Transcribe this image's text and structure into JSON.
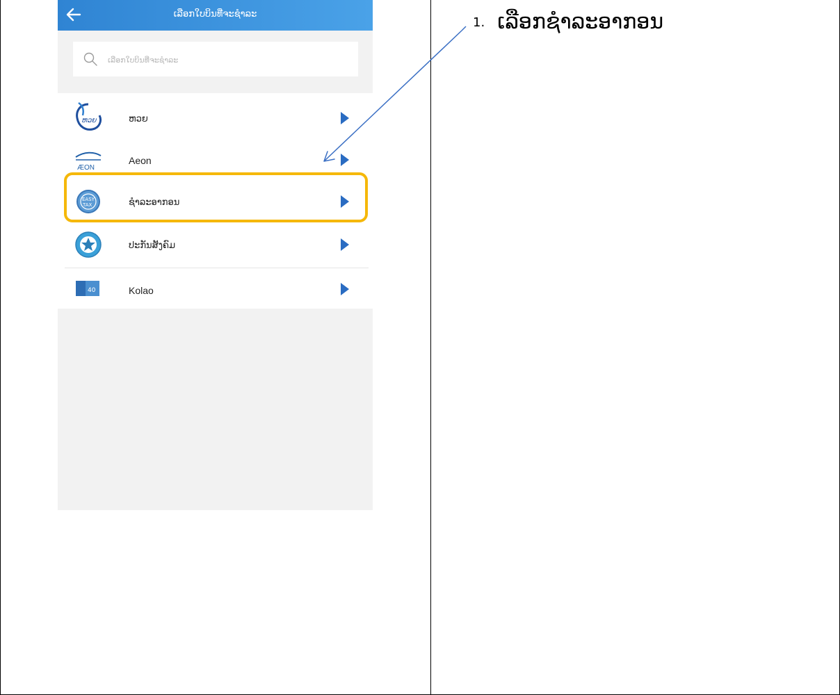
{
  "header": {
    "title": "ເລືອກໃບບິນທີ່ຈະຊຳລະ",
    "back_icon": "arrow-left-icon"
  },
  "search": {
    "placeholder": "ເລືອກໃບບິນທີ່ຈະຊຳລະ",
    "icon": "search-icon"
  },
  "billers": [
    {
      "label": "ຫວຍ",
      "logo": "lottery-logo"
    },
    {
      "label": "Aeon",
      "logo": "aeon-logo"
    },
    {
      "label": "ຊຳລະອາກອນ",
      "logo": "etax-logo"
    },
    {
      "label": "ປະກັນສັງຄົມ",
      "logo": "social-security-logo"
    },
    {
      "label": "Kolao",
      "logo": "kolao-logo"
    }
  ],
  "instruction": {
    "number": "1.",
    "text": "ເລືອກຊຳລະອາກອນ"
  },
  "colors": {
    "header_blue": "#2f84d3",
    "arrow_blue": "#1f5fa8",
    "highlight": "#f5b80a"
  }
}
